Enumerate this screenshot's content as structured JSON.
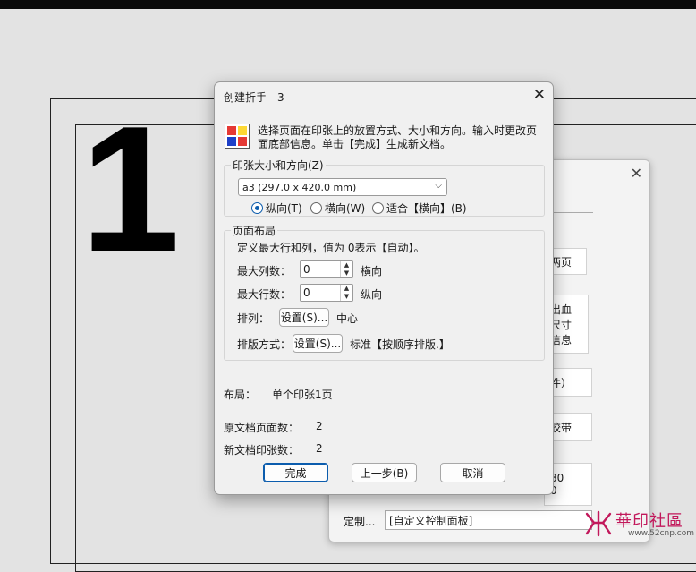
{
  "background": {
    "page_number": "1"
  },
  "back_dialog": {
    "close_glyph": "✕",
    "items": [
      {
        "text": "两页"
      },
      {
        "text": "出血"
      },
      {
        "text": "尺寸"
      },
      {
        "text": "信息"
      },
      {
        "text": "件）"
      },
      {
        "text": "胶带"
      },
      {
        "text": "80"
      },
      {
        "text": "0"
      }
    ],
    "custom_label": "定制...",
    "custom_select": "[自定义控制面板]"
  },
  "dialog": {
    "title": "创建折手 - 3",
    "close_glyph": "✕",
    "description": "选择页面在印张上的放置方式、大小和方向。输入时更改页面底部信息。单击【完成】生成新文档。",
    "sheet_group": {
      "title": "印张大小和方向(Z)",
      "size_value": "a3 (297.0 x 420.0 mm)",
      "orientations": [
        {
          "label": "纵向(T)",
          "selected": true
        },
        {
          "label": "横向(W)",
          "selected": false
        },
        {
          "label": "适合【横向】(B)",
          "selected": false
        }
      ]
    },
    "layout_group": {
      "title": "页面布局",
      "hint": "定义最大行和列，值为 0表示【自动】。",
      "max_cols_label": "最大列数：",
      "max_cols_value": "0",
      "max_cols_dir": "横向",
      "max_rows_label": "最大行数：",
      "max_rows_value": "0",
      "max_rows_dir": "纵向",
      "arrange_label": "排列：",
      "arrange_button": "设置(S)...",
      "arrange_value": "中心",
      "order_label": "排版方式：",
      "order_button": "设置(S)...",
      "order_value": "标准【按顺序排版.】"
    },
    "summary": {
      "layout_label": "布局：",
      "layout_value": "单个印张1页",
      "orig_pages_label": "原文档页面数：",
      "orig_pages_value": "2",
      "new_sheets_label": "新文档印张数：",
      "new_sheets_value": "2"
    },
    "buttons": {
      "finish": "完成",
      "back": "上一步(B)",
      "cancel": "取消"
    }
  },
  "watermark": {
    "text": "華印社區",
    "url": "www.52cnp.com"
  },
  "colors": {
    "accent": "#0b5cad",
    "icon_red": "#e53935",
    "icon_yellow": "#fdd835",
    "icon_blue": "#1e40c8",
    "watermark": "#c2185b"
  }
}
